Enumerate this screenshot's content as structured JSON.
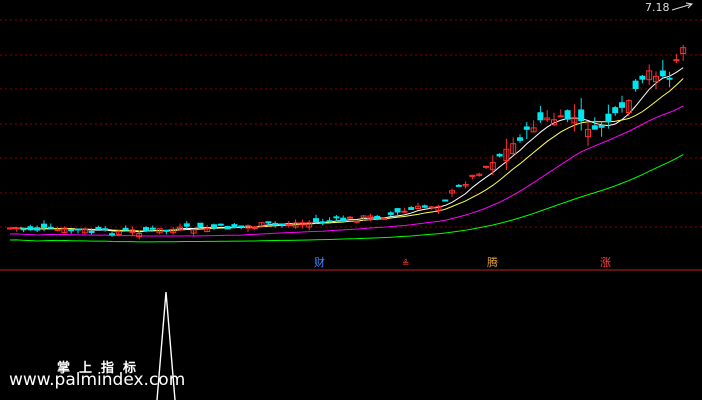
{
  "price_label": "7.18",
  "markers": [
    {
      "text": "财",
      "color": "#4a86ff"
    },
    {
      "text": "≗",
      "color": "#ff4a4a"
    },
    {
      "text": "腾",
      "color": "#e0a040"
    },
    {
      "text": "涨",
      "color": "#ff4040"
    }
  ],
  "watermark": {
    "title": "掌上指标",
    "url": "www.palmindex.com"
  },
  "colors": {
    "background": "#000000",
    "grid": "#8b0000",
    "divider": "#c02020",
    "up_candle": "#ff3030",
    "down_candle": "#00e5ee",
    "ma_short": "#ffffff",
    "ma_mid": "#ffff55",
    "ma_long": "#ff00ff",
    "ma_longest": "#00ff00",
    "indicator_spike": "#ffffff"
  }
}
